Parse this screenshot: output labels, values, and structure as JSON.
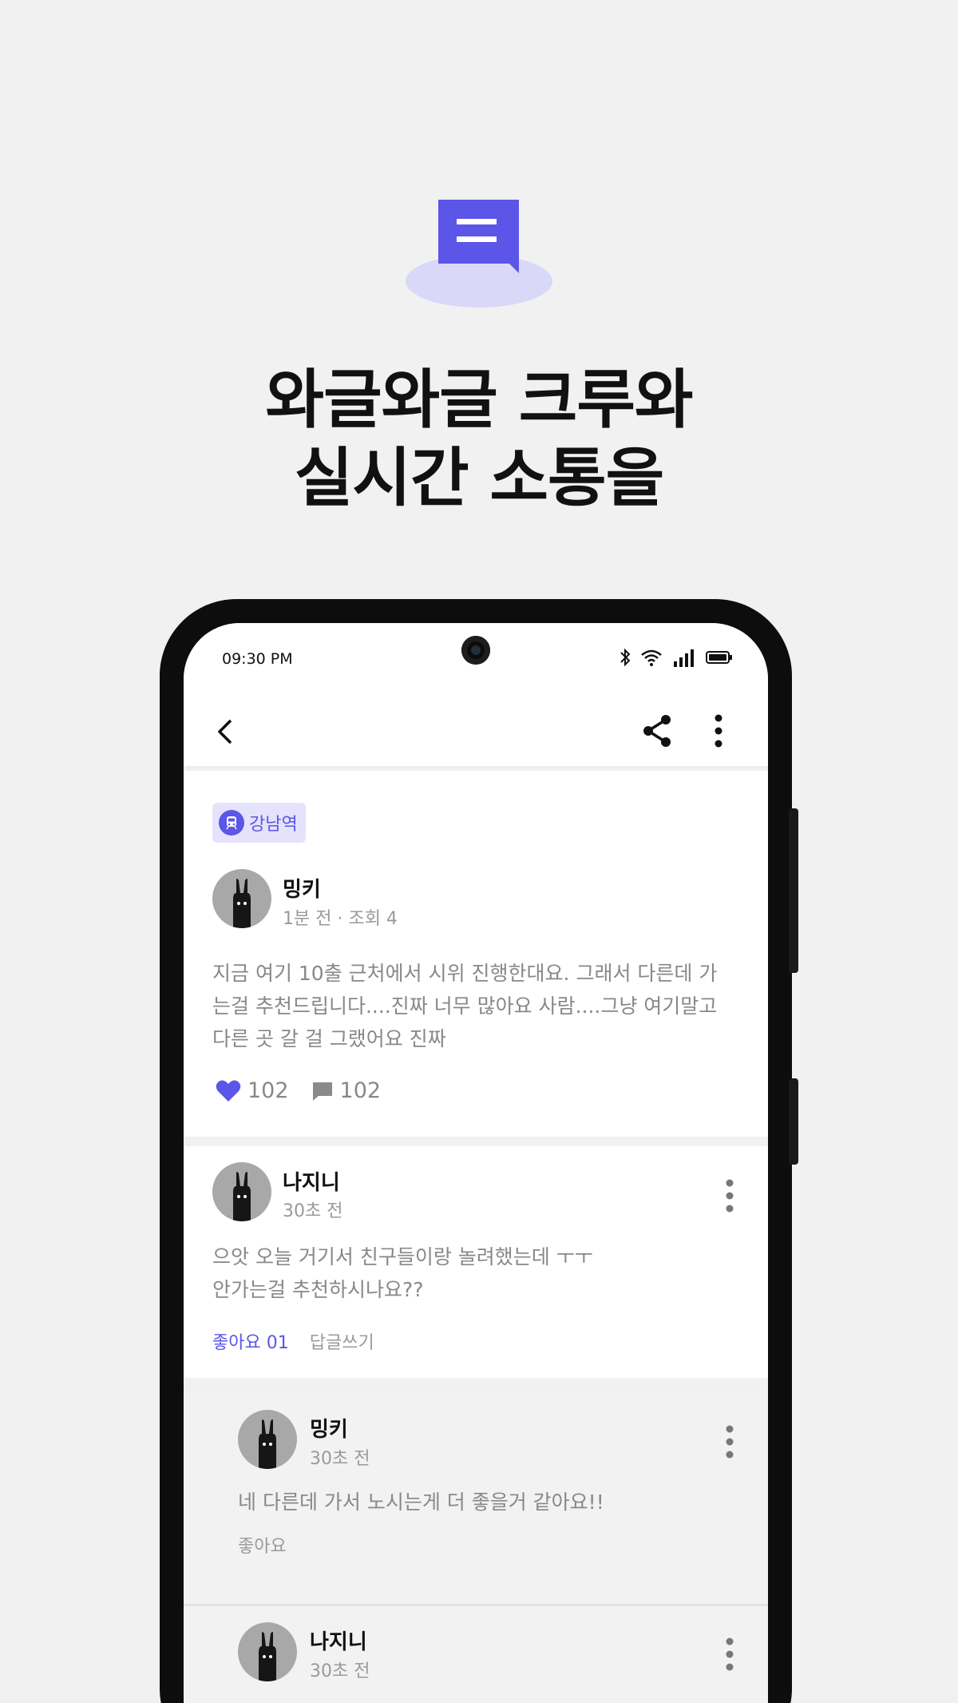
{
  "hero": {
    "icon": "chat-bubble-icon",
    "headline_line1": "와글와글 크루와",
    "headline_line2": "실시간 소통을"
  },
  "colors": {
    "accent": "#5b55e8",
    "accent_light": "#d9d8f8",
    "background": "#f1f1f1"
  },
  "statusbar": {
    "time": "09:30 PM",
    "icons": [
      "bluetooth-icon",
      "wifi-icon",
      "signal-icon",
      "battery-icon"
    ]
  },
  "appbar": {
    "icons": [
      "back-icon",
      "share-icon",
      "more-icon"
    ]
  },
  "post": {
    "tag": "강남역",
    "author": "밍키",
    "meta": "1분 전 · 조회 4",
    "body_line1": "지금 여기 10출 근처에서 시위 진행한대요. 그래서 다른데 가",
    "body_line2": "는걸 추천드립니다....진짜 너무 많아요 사람....그냥 여기말고",
    "body_line3": "다른 곳 갈 걸 그랬어요 진짜",
    "likes": "102",
    "comments": "102"
  },
  "comments": [
    {
      "author": "나지니",
      "time": "30초 전",
      "text_line1": "으앗 오늘 거기서 친구들이랑 놀려했는데 ㅜㅜ",
      "text_line2": "안가는걸 추천하시나요??",
      "like_label": "좋아요 01",
      "reply_label": "답글쓰기"
    },
    {
      "author": "밍키",
      "time": "30초 전",
      "text_line1": "네 다른데 가서 노시는게 더 좋을거 같아요!!",
      "like_label": "좋아요"
    },
    {
      "author": "나지니",
      "time": "30초 전"
    }
  ]
}
